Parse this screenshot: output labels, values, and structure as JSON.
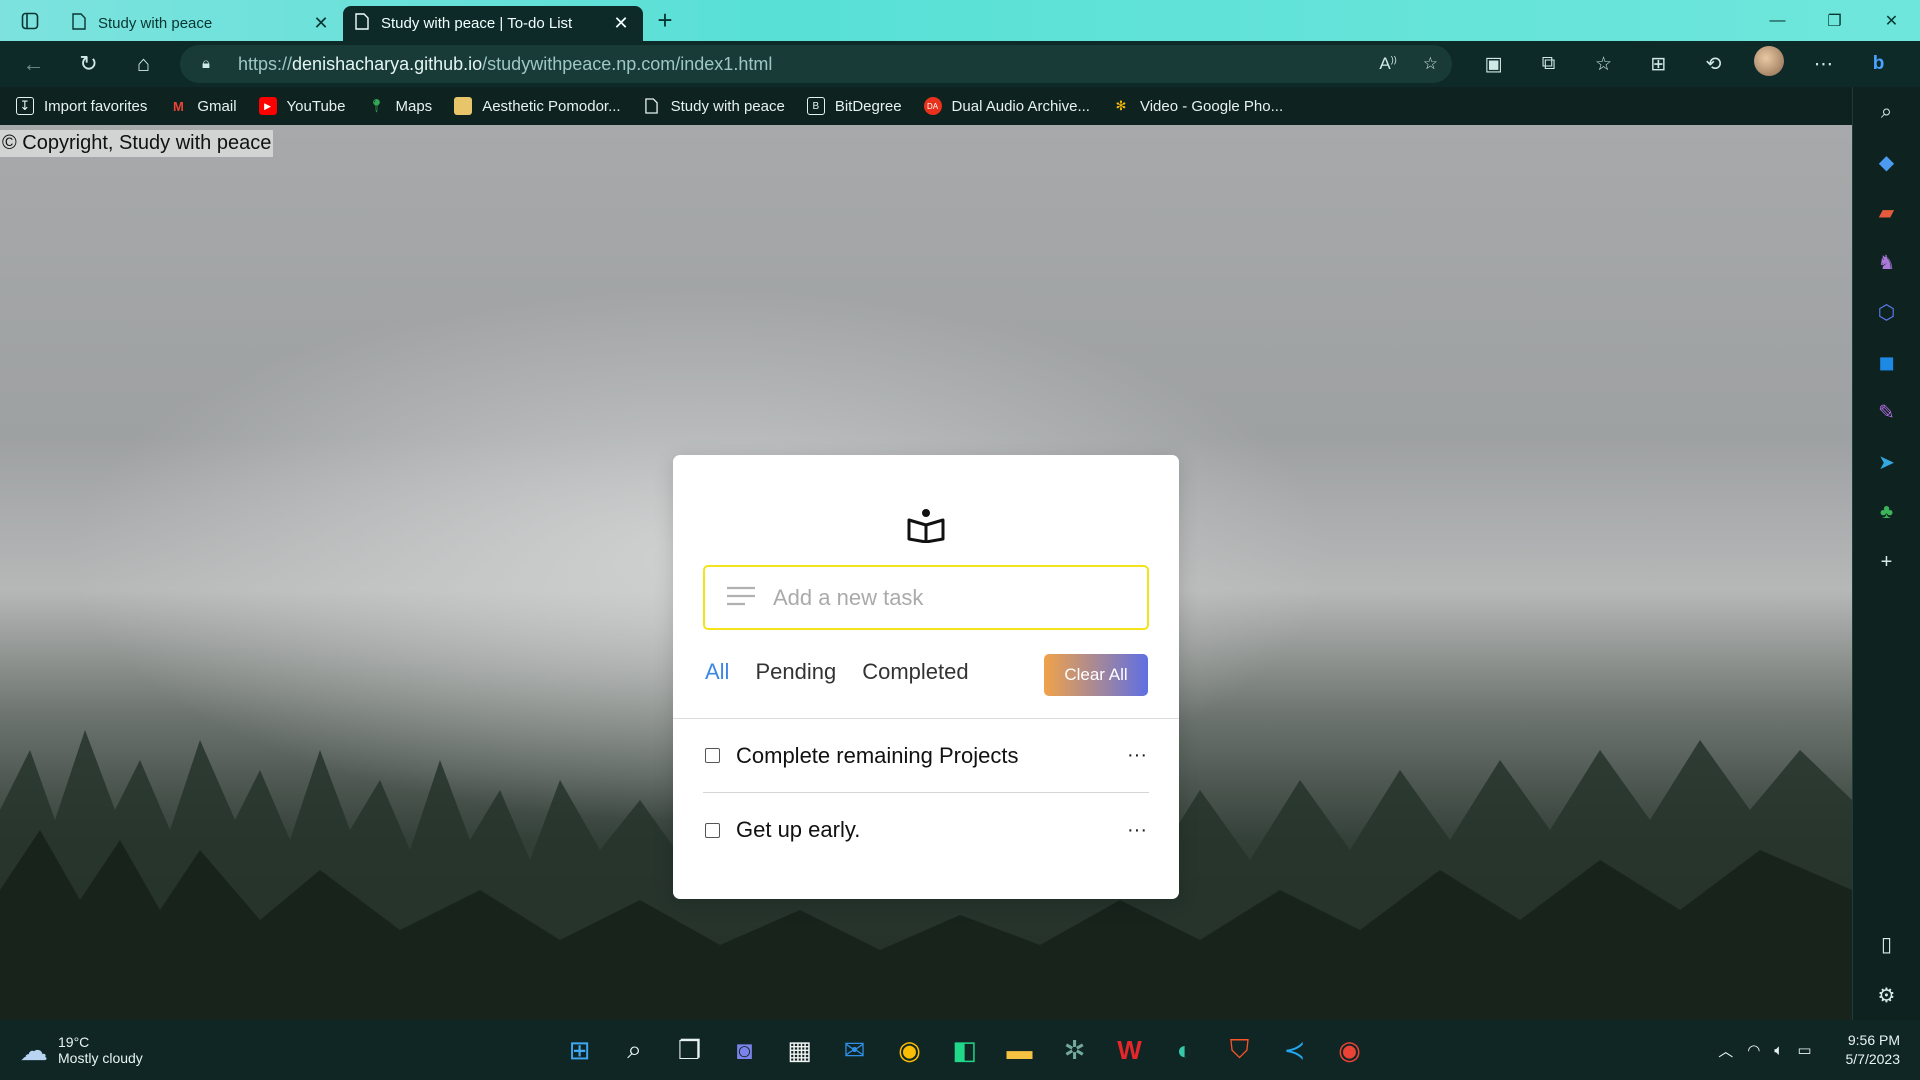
{
  "browser": {
    "tabs": [
      {
        "label": "Study with peace",
        "active": false
      },
      {
        "label": "Study with peace | To-do List",
        "active": true
      }
    ],
    "url": {
      "scheme": "https://",
      "host": "denishacharya.github.io",
      "path": "/studywithpeace.np.com/index1.html"
    },
    "favorites": [
      {
        "label": "Import favorites",
        "icon": "import-icon"
      },
      {
        "label": "Gmail",
        "icon": "gmail-icon"
      },
      {
        "label": "YouTube",
        "icon": "youtube-icon"
      },
      {
        "label": "Maps",
        "icon": "maps-pin-icon"
      },
      {
        "label": "Aesthetic Pomodor...",
        "icon": "bookmark-folder-icon"
      },
      {
        "label": "Study with peace",
        "icon": "page-icon"
      },
      {
        "label": "BitDegree",
        "icon": "bitdegree-icon"
      },
      {
        "label": "Dual Audio Archive...",
        "icon": "dual-audio-icon"
      },
      {
        "label": "Video - Google Pho...",
        "icon": "google-photos-icon"
      }
    ]
  },
  "page": {
    "copyright": "© Copyright, Study with peace",
    "todo": {
      "placeholder": "Add a new task",
      "filters": [
        "All",
        "Pending",
        "Completed"
      ],
      "active_filter": "All",
      "clear_label": "Clear All",
      "tasks": [
        {
          "text": "Complete remaining Projects",
          "done": false
        },
        {
          "text": "Get up early.",
          "done": false
        }
      ],
      "more_glyph": "···"
    }
  },
  "taskbar": {
    "weather": {
      "temp": "19°C",
      "desc": "Mostly cloudy"
    },
    "clock": {
      "time": "9:56 PM",
      "date": "5/7/2023"
    }
  },
  "colors": {
    "accent": "#3c87e6",
    "input_border": "#f3e31b",
    "clear_gradient_start": "#f0a24a",
    "clear_gradient_end": "#5f6fe3",
    "chrome_bg": "#0e2a28"
  }
}
